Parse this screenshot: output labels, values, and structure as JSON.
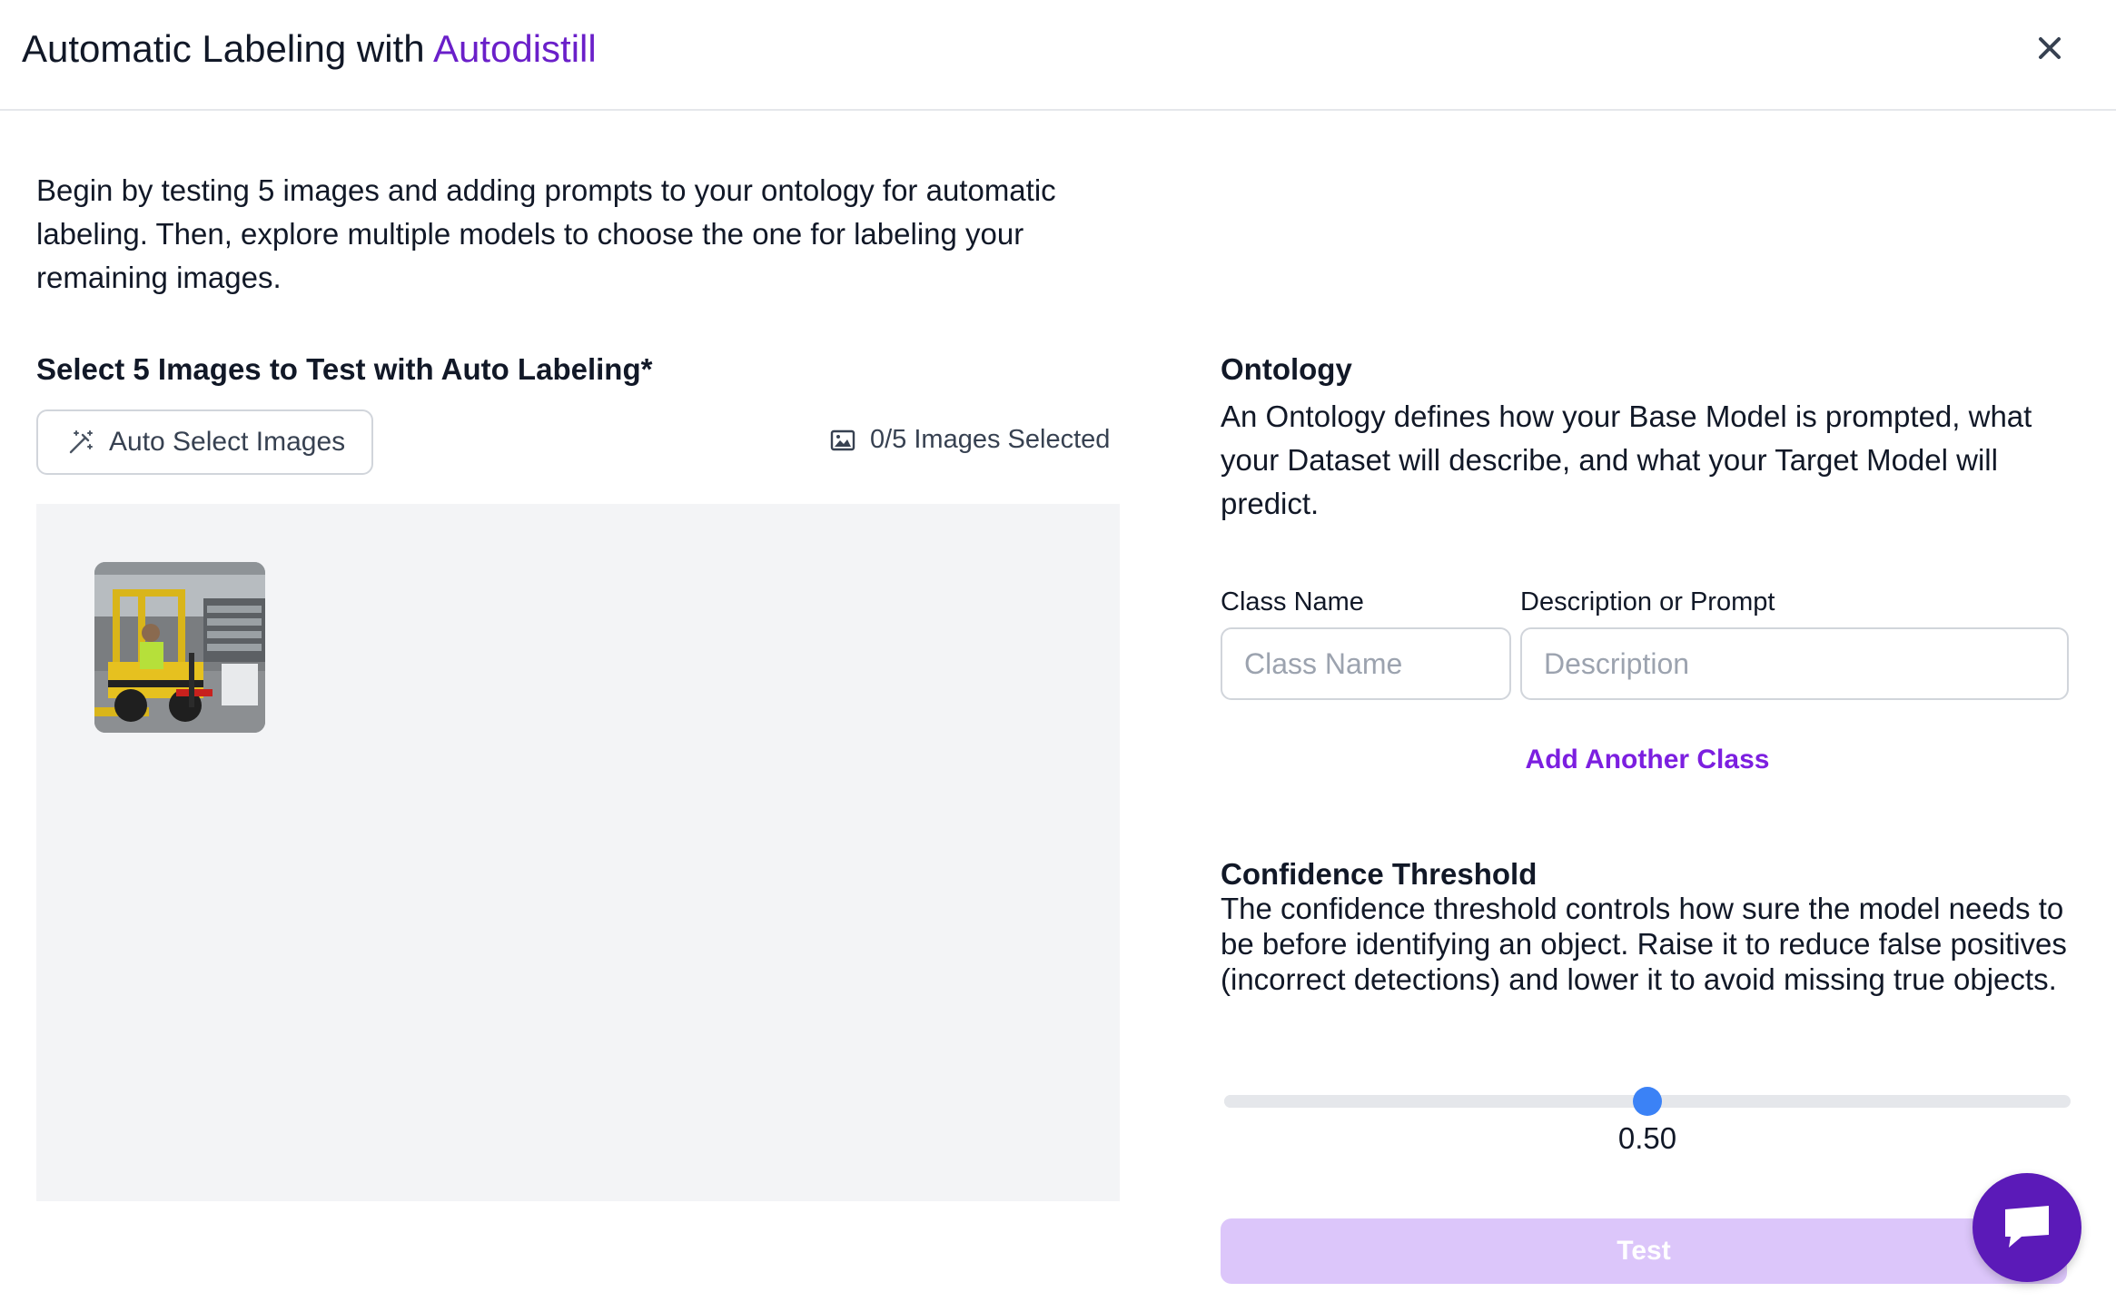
{
  "header": {
    "title_prefix": "Automatic Labeling with",
    "title_accent": "Autodistill",
    "close_icon": "close-icon"
  },
  "intro": "Begin by testing 5 images and adding prompts to your ontology for automatic labeling. Then, explore multiple models to choose the one for labeling your remaining images.",
  "image_selection": {
    "label": "Select 5 Images to Test with Auto Labeling*",
    "auto_select_label": "Auto Select Images",
    "auto_select_icon": "magic-wand-icon",
    "selected_icon": "image-icon",
    "selected_text": "0/5 Images Selected",
    "thumbnails": [
      {
        "name": "forklift-warehouse-image"
      }
    ]
  },
  "ontology": {
    "heading": "Ontology",
    "description": "An Ontology defines how your Base Model is prompted, what your Dataset will describe, and what your Target Model will predict.",
    "class_name_label": "Class Name",
    "class_name_placeholder": "Class Name",
    "description_label": "Description or Prompt",
    "description_placeholder": "Description",
    "add_class_label": "Add Another Class"
  },
  "confidence": {
    "heading": "Confidence Threshold",
    "description": "The confidence threshold controls how sure the model needs to be before identifying an object. Raise it to reduce false positives (incorrect detections) and lower it to avoid missing true objects.",
    "value": 0.5,
    "value_label": "0.50",
    "min": 0,
    "max": 1
  },
  "test_label": "Test",
  "chat_icon": "chat-bubble-icon",
  "colors": {
    "accent": "#6a1fc9",
    "link": "#7c1fe0",
    "slider_thumb": "#3b82f6",
    "test_button_disabled": "#dcc6fa",
    "chat_fab": "#5b1ab8"
  }
}
